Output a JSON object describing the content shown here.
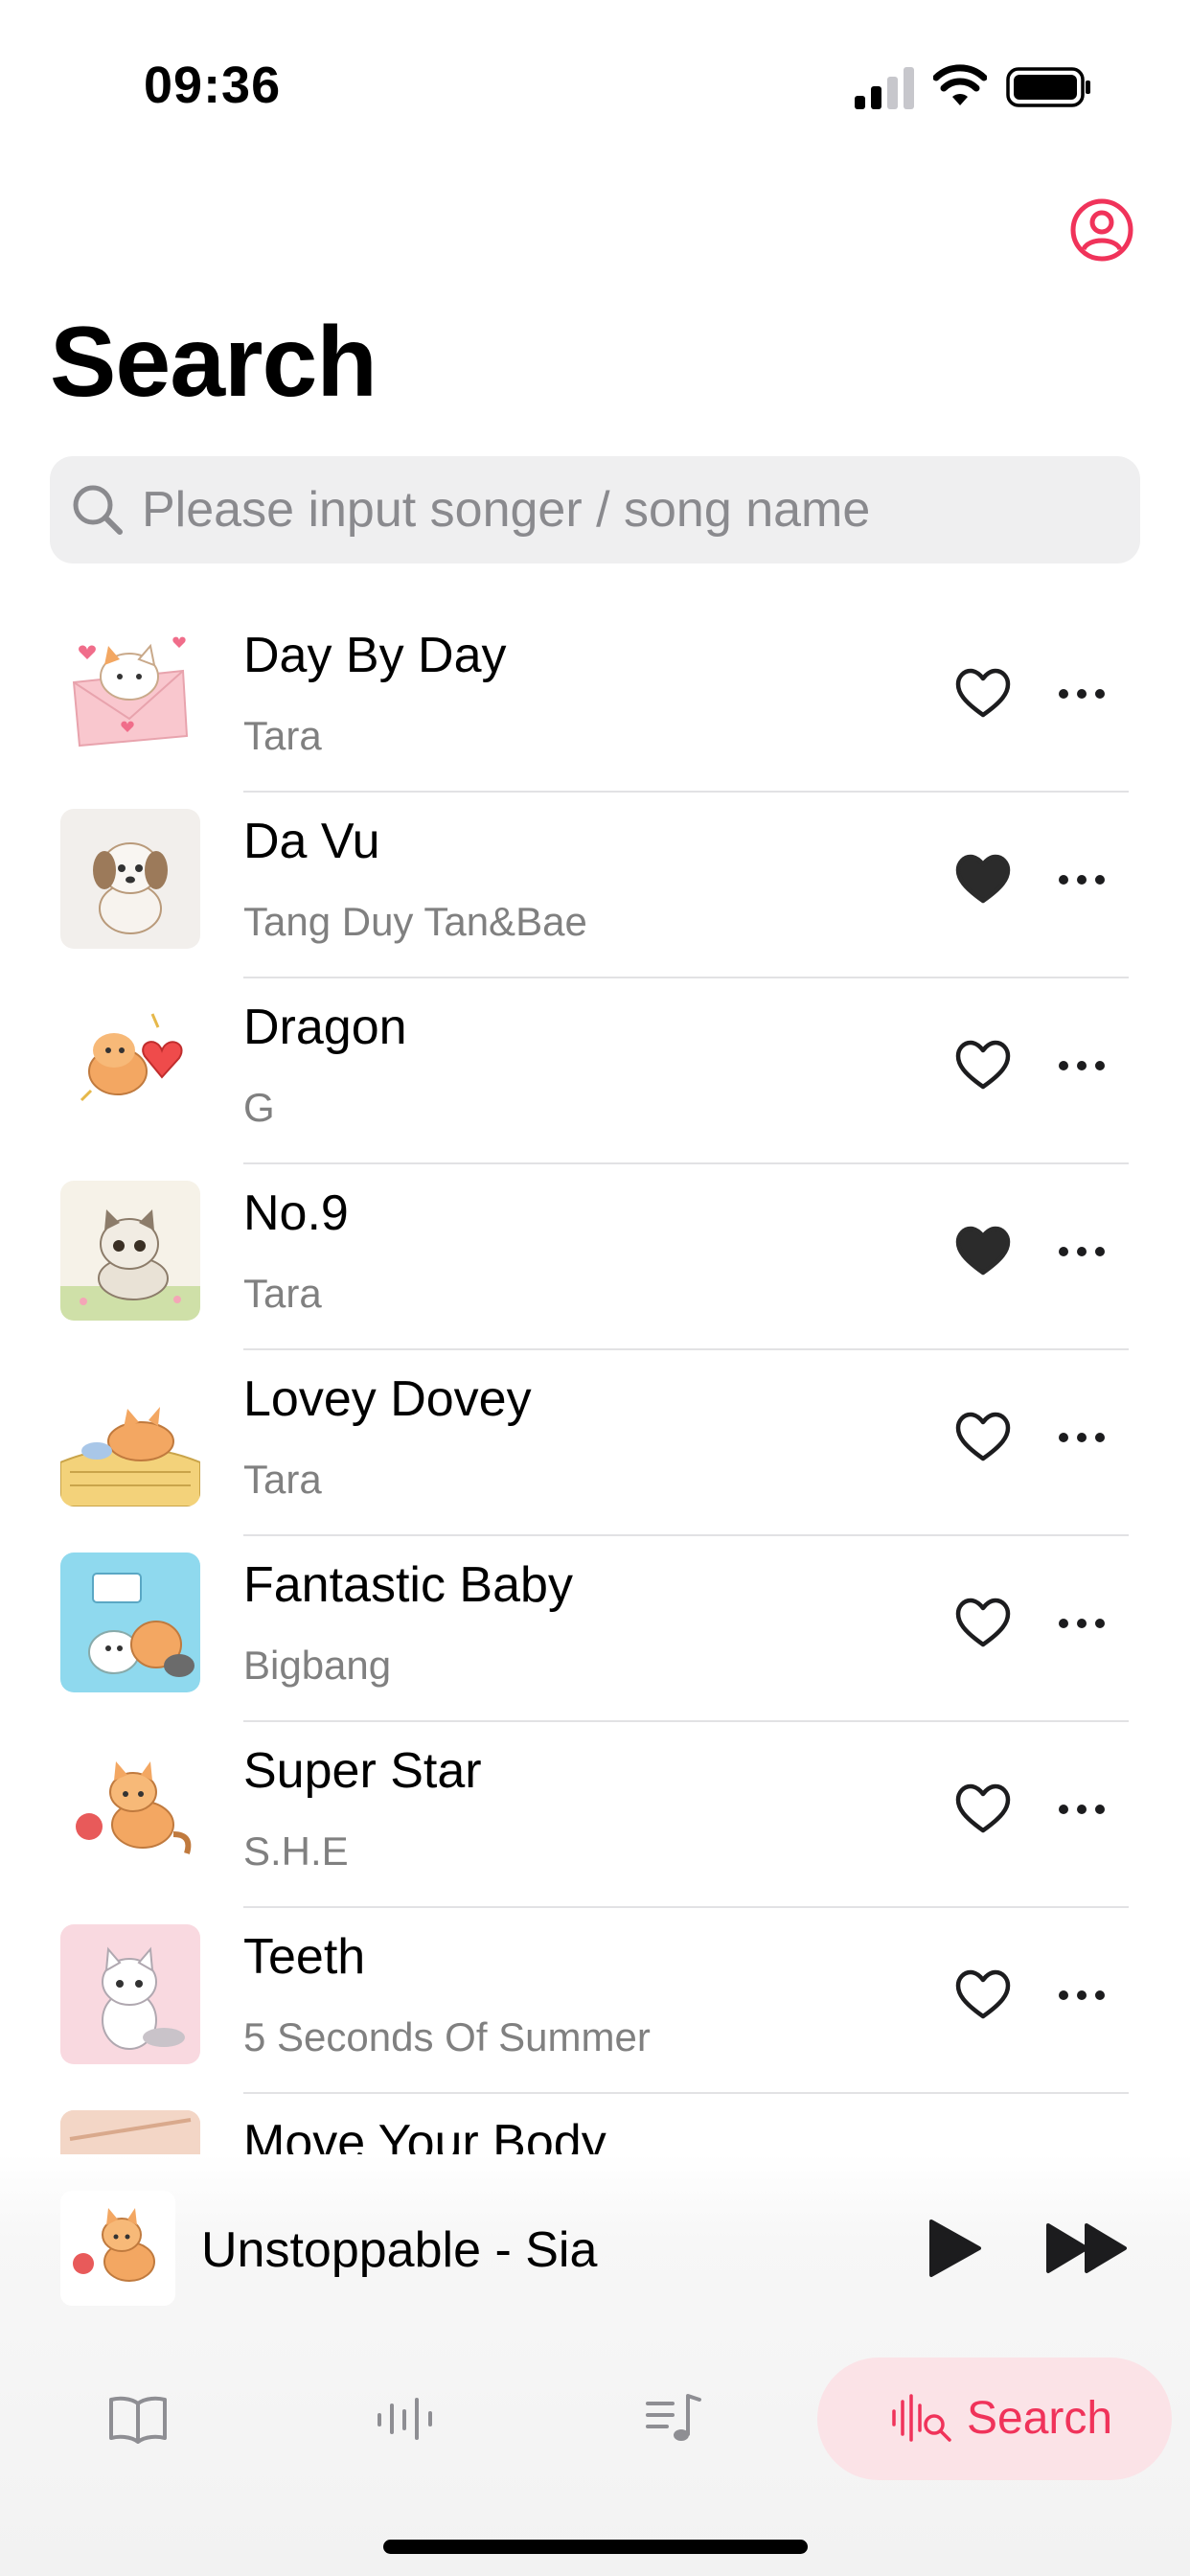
{
  "status_bar": {
    "time": "09:36"
  },
  "header": {
    "title": "Search",
    "profile_icon": "person-circle-icon"
  },
  "search": {
    "placeholder": "Please input songer / song name",
    "value": ""
  },
  "songs": [
    {
      "title": "Day By Day",
      "artist": "Tara",
      "liked": false
    },
    {
      "title": "Da Vu",
      "artist": "Tang Duy Tan&Bae",
      "liked": true
    },
    {
      "title": "Dragon",
      "artist": "G",
      "liked": false
    },
    {
      "title": "No.9",
      "artist": "Tara",
      "liked": true
    },
    {
      "title": "Lovey Dovey",
      "artist": "Tara",
      "liked": false
    },
    {
      "title": "Fantastic Baby",
      "artist": "Bigbang",
      "liked": false
    },
    {
      "title": "Super Star",
      "artist": "S.H.E",
      "liked": false
    },
    {
      "title": "Teeth",
      "artist": "5 Seconds Of Summer",
      "liked": false
    },
    {
      "title": "Move Your Body",
      "artist": "",
      "liked": false
    }
  ],
  "now_playing": {
    "label": "Unstoppable - Sia"
  },
  "tabs": [
    {
      "icon": "book-icon",
      "label": ""
    },
    {
      "icon": "waveform-icon",
      "label": ""
    },
    {
      "icon": "playlist-icon",
      "label": ""
    },
    {
      "icon": "waveform-search-icon",
      "label": "Search",
      "active": true
    }
  ],
  "colors": {
    "accent": "#f0335a",
    "active_tab_bg": "#fbe3e7",
    "search_bg": "#efeff0",
    "secondary_text": "#808080"
  }
}
